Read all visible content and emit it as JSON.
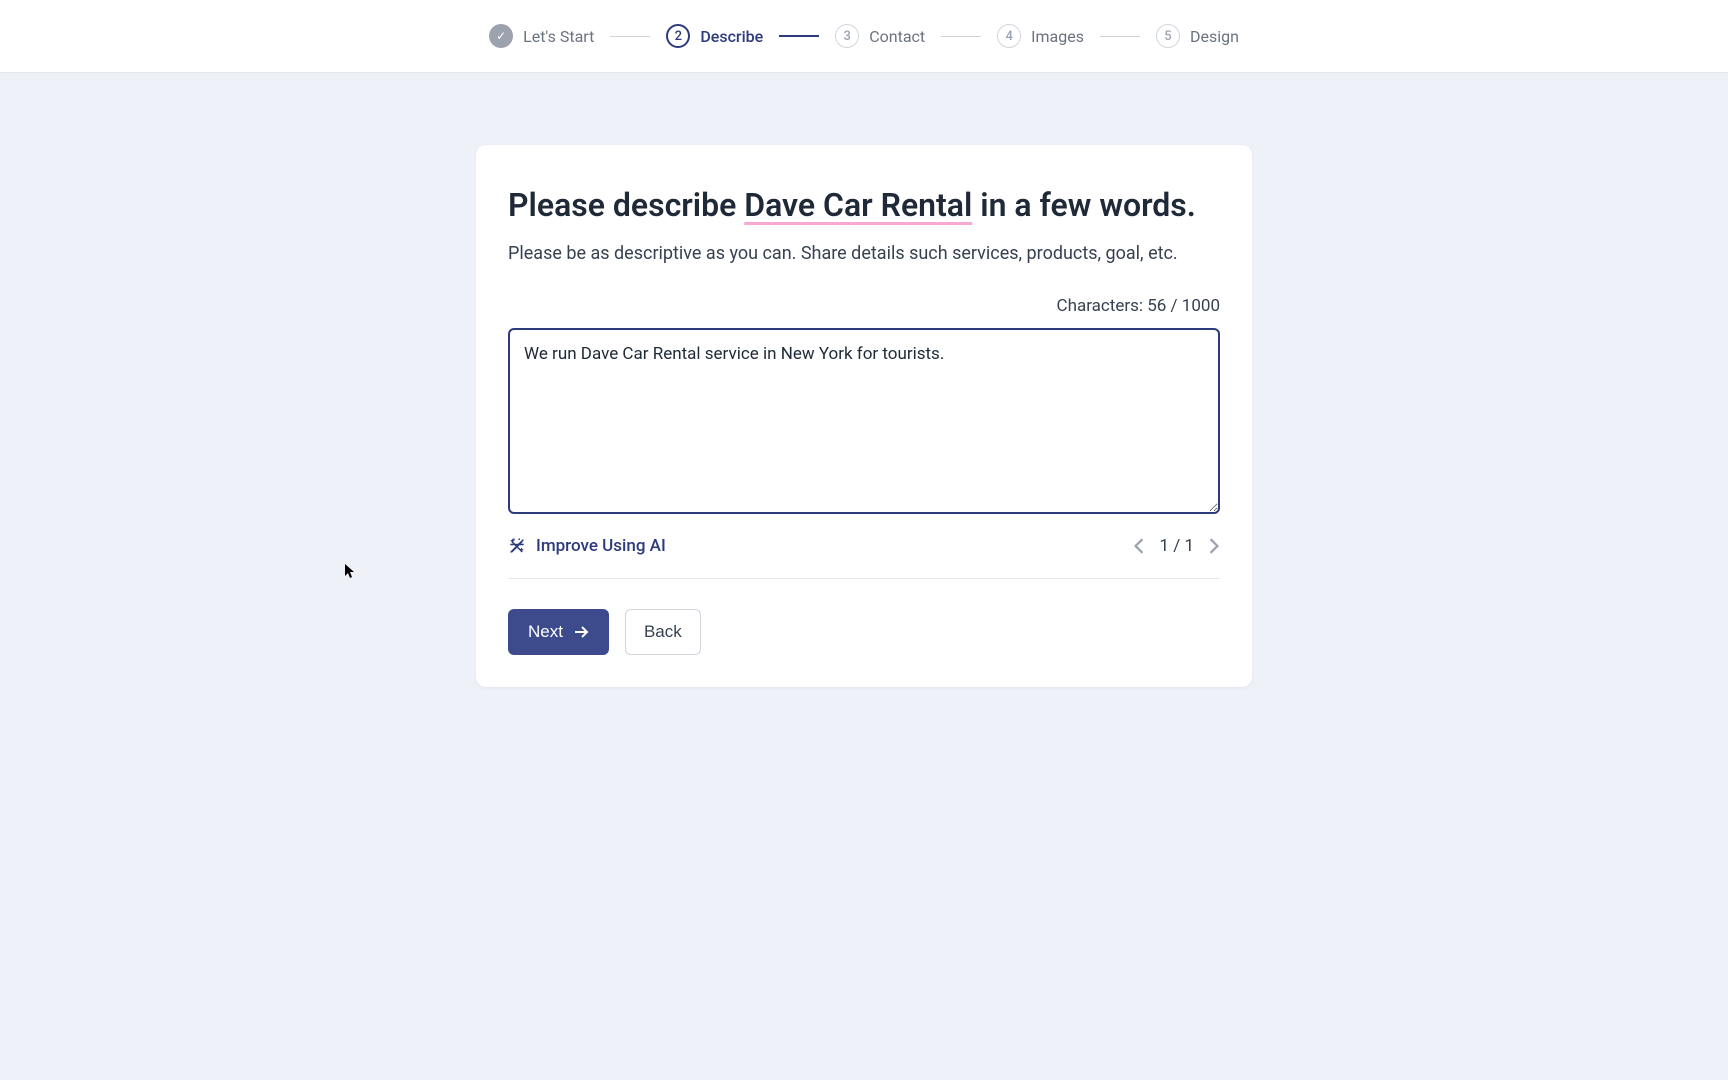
{
  "stepper": {
    "steps": [
      {
        "number": "✓",
        "label": "Let's Start",
        "state": "completed"
      },
      {
        "number": "2",
        "label": "Describe",
        "state": "active"
      },
      {
        "number": "3",
        "label": "Contact",
        "state": "upcoming"
      },
      {
        "number": "4",
        "label": "Images",
        "state": "upcoming"
      },
      {
        "number": "5",
        "label": "Design",
        "state": "upcoming"
      }
    ]
  },
  "card": {
    "title_prefix": "Please describe ",
    "title_highlight": "Dave Car Rental",
    "title_suffix": " in a few words.",
    "subtitle": "Please be as descriptive as you can. Share details such services, products, goal, etc.",
    "char_count_label": "Characters: ",
    "char_count_value": "56 / 1000",
    "textarea_value": "We run Dave Car Rental service in New York for tourists.",
    "improve_ai_label": "Improve Using AI",
    "pagination_text": "1 / 1",
    "next_label": "Next",
    "back_label": "Back"
  }
}
